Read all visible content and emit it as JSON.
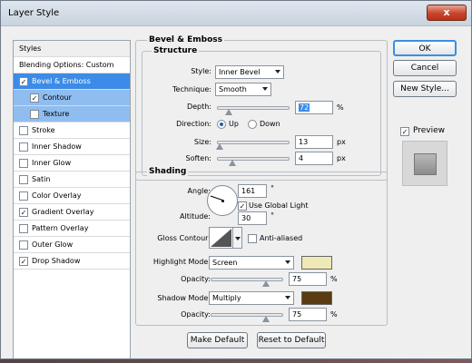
{
  "window": {
    "title": "Layer Style",
    "close_glyph": "x"
  },
  "styles_list": {
    "header": "Styles",
    "blending": "Blending Options: Custom",
    "items": [
      {
        "label": "Bevel & Emboss",
        "checked": true,
        "state": "selected"
      },
      {
        "label": "Contour",
        "checked": true,
        "state": "sub"
      },
      {
        "label": "Texture",
        "checked": false,
        "state": "sub"
      },
      {
        "label": "Stroke",
        "checked": false
      },
      {
        "label": "Inner Shadow",
        "checked": false
      },
      {
        "label": "Inner Glow",
        "checked": false
      },
      {
        "label": "Satin",
        "checked": false
      },
      {
        "label": "Color Overlay",
        "checked": false
      },
      {
        "label": "Gradient Overlay",
        "checked": true
      },
      {
        "label": "Pattern Overlay",
        "checked": false
      },
      {
        "label": "Outer Glow",
        "checked": false
      },
      {
        "label": "Drop Shadow",
        "checked": true
      }
    ]
  },
  "buttons": {
    "ok": "OK",
    "cancel": "Cancel",
    "new_style": "New Style...",
    "make_default": "Make Default",
    "reset_default": "Reset to Default"
  },
  "preview": {
    "label": "Preview",
    "checked": true
  },
  "bevel": {
    "group_title": "Bevel & Emboss",
    "structure_title": "Structure",
    "style_label": "Style:",
    "style_value": "Inner Bevel",
    "technique_label": "Technique:",
    "technique_value": "Smooth",
    "depth_label": "Depth:",
    "depth_value": "72",
    "depth_unit": "%",
    "direction_label": "Direction:",
    "dir_up": "Up",
    "dir_down": "Down",
    "direction_selected": "Up",
    "size_label": "Size:",
    "size_value": "13",
    "size_unit": "px",
    "soften_label": "Soften:",
    "soften_value": "4",
    "soften_unit": "px"
  },
  "shading": {
    "title": "Shading",
    "angle_label": "Angle:",
    "angle_value": "161",
    "angle_unit": "°",
    "global_light_label": "Use Global Light",
    "global_light_checked": true,
    "altitude_label": "Altitude:",
    "altitude_value": "30",
    "altitude_unit": "°",
    "gloss_label": "Gloss Contour:",
    "antialiased_label": "Anti-aliased",
    "antialiased_checked": false,
    "highlight_mode_label": "Highlight Mode:",
    "highlight_mode_value": "Screen",
    "highlight_color": "#efe9b8",
    "highlight_opacity_label": "Opacity:",
    "highlight_opacity_value": "75",
    "highlight_opacity_unit": "%",
    "shadow_mode_label": "Shadow Mode:",
    "shadow_mode_value": "Multiply",
    "shadow_color": "#5a3b12",
    "shadow_opacity_label": "Opacity:",
    "shadow_opacity_value": "75",
    "shadow_opacity_unit": "%"
  },
  "colors": {
    "selection": "#3c8be6",
    "sub_selection": "#8fbdf0"
  }
}
